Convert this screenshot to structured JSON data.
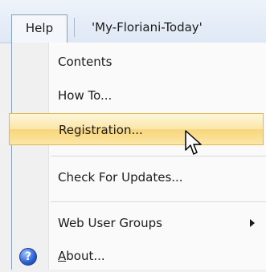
{
  "menubar": {
    "help_label": "Help",
    "title": "'My-Floriani-Today'"
  },
  "menu": {
    "items": [
      {
        "label": "Contents"
      },
      {
        "label": "How To..."
      },
      {
        "label": "Registration...",
        "highlighted": true
      },
      {
        "label": "Check For Updates..."
      },
      {
        "label": "Web User Groups",
        "has_submenu": true
      },
      {
        "label_first": "A",
        "label_rest": "bout...",
        "icon": "help-circle-icon"
      }
    ]
  },
  "colors": {
    "highlight": "#fbe6a6",
    "highlight_border": "#e0b84c",
    "menubar": "#dfe8f5",
    "help_icon": "#2a5fcf"
  }
}
